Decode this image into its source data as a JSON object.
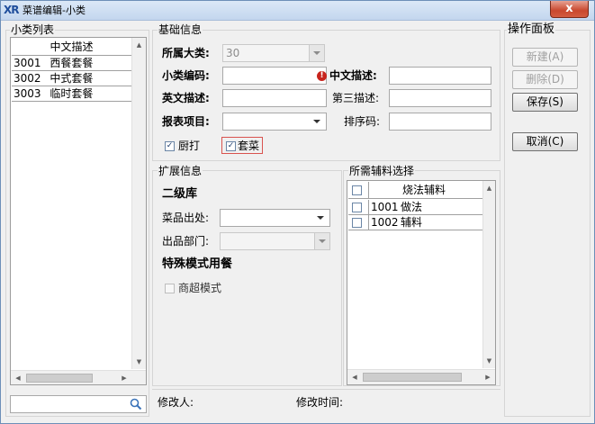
{
  "window": {
    "title": "菜谱编辑-小类",
    "app_icon": "xr-logo-icon",
    "close_label": "x"
  },
  "left_panel": {
    "title": "小类列表",
    "column_header": "中文描述",
    "rows": [
      {
        "code": "3001",
        "name": "西餐套餐"
      },
      {
        "code": "3002",
        "name": "中式套餐"
      },
      {
        "code": "3003",
        "name": "临时套餐"
      }
    ],
    "search_value": ""
  },
  "basic_info": {
    "title": "基础信息",
    "category_label": "所属大类:",
    "category_value": "30",
    "code_label": "小类编码:",
    "code_value": "",
    "cn_desc_label": "中文描述:",
    "cn_desc_value": "",
    "en_desc_label": "英文描述:",
    "en_desc_value": "",
    "third_desc_label": "第三描述:",
    "third_desc_value": "",
    "report_label": "报表项目:",
    "report_value": "",
    "sort_label": "排序码:",
    "sort_value": "",
    "kitchen_print_label": "厨打",
    "kitchen_print_checked": true,
    "set_meal_label": "套菜",
    "set_meal_checked": true
  },
  "extended_info": {
    "title": "扩展信息",
    "second_store_label": "二级库",
    "origin_label": "菜品出处:",
    "origin_value": "",
    "dept_label": "出品部门:",
    "dept_value": "",
    "special_mode_label": "特殊模式用餐",
    "supermarket_label": "商超模式",
    "supermarket_checked": false
  },
  "aux_panel": {
    "title": "所需辅料选择",
    "column_header": "烧法辅料",
    "rows": [
      {
        "code": "1001",
        "name": "做法",
        "checked": false
      },
      {
        "code": "1002",
        "name": "辅料",
        "checked": false
      }
    ]
  },
  "operations": {
    "title": "操作面板",
    "new_label": "新建(A)",
    "delete_label": "删除(D)",
    "save_label": "保存(S)",
    "cancel_label": "取消(C)"
  },
  "footer": {
    "modifier_label": "修改人:",
    "modifier_value": "",
    "modify_time_label": "修改时间:",
    "modify_time_value": ""
  },
  "colors": {
    "titlebar": "#c3d6ee",
    "close_button": "#c9482e",
    "window_bg": "#f0f0f0",
    "highlight_border": "#d9534f"
  }
}
